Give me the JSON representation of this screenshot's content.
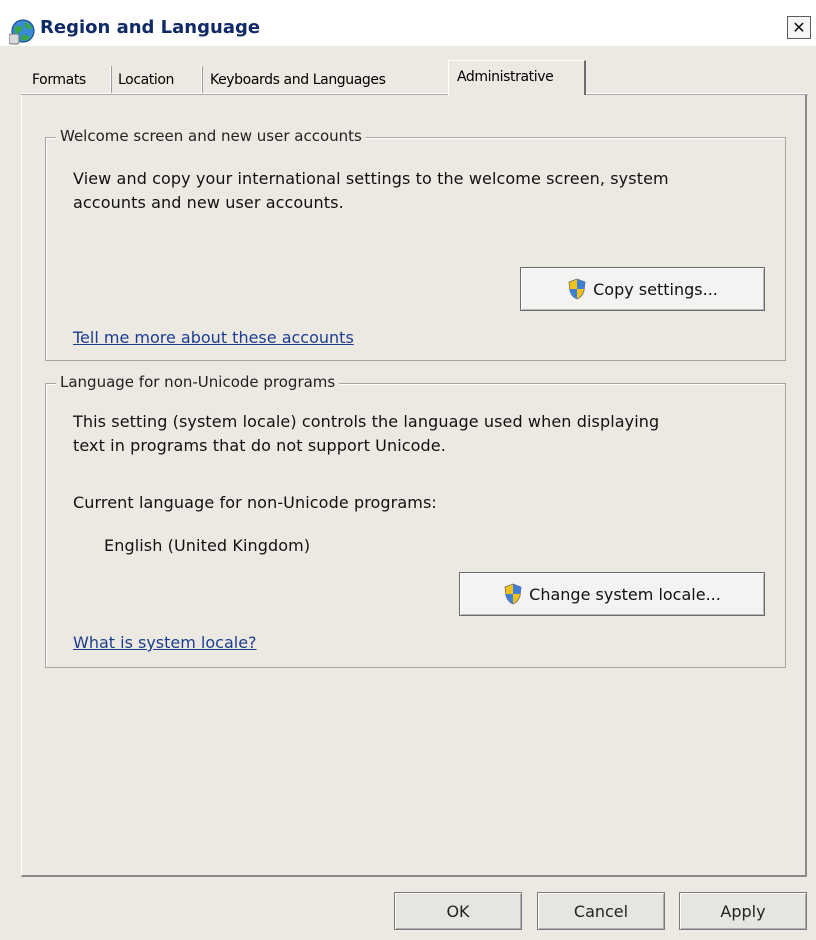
{
  "window": {
    "title": "Region and Language",
    "close_symbol": "✕",
    "title_icon": "globe-icon"
  },
  "tabs": [
    {
      "label": "Formats",
      "active": false
    },
    {
      "label": "Location",
      "active": false
    },
    {
      "label": "Keyboards and Languages",
      "active": false
    },
    {
      "label": "Administrative",
      "active": true
    }
  ],
  "welcome_group": {
    "legend": "Welcome screen and new user accounts",
    "line1": "View and copy your international settings to the welcome screen, system",
    "line2": "accounts and new user accounts.",
    "copy_button": "Copy settings...",
    "button_icon": "uac-shield-icon",
    "link": "Tell me more about these accounts"
  },
  "locale_group": {
    "legend": "Language for non-Unicode programs",
    "line1": "This setting (system locale) controls the language used when displaying",
    "line2": "text in programs that do not support Unicode.",
    "current_label": "Current language for non-Unicode programs:",
    "current_value": "English (United Kingdom)",
    "change_button": "Change system locale...",
    "button_icon": "uac-shield-icon",
    "link": "What is system locale?"
  },
  "footer": {
    "ok": "OK",
    "cancel": "Cancel",
    "apply": "Apply"
  },
  "colors": {
    "dialog_background": "#ece9e2",
    "title_text": "#0f2a66",
    "link": "#1c3d8f"
  }
}
